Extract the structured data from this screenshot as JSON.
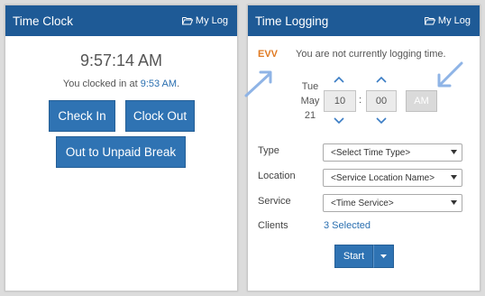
{
  "time_clock": {
    "title": "Time Clock",
    "my_log_label": "My Log",
    "current_time": "9:57:14 AM",
    "clocked_in_prefix": "You clocked in at",
    "clocked_in_time": "9:53 AM",
    "clocked_in_suffix": ".",
    "clock_in_label": "Check In",
    "clock_out_label": "Clock Out",
    "unpaid_break_label": "Out to Unpaid Break"
  },
  "time_logging": {
    "title": "Time Logging",
    "my_log_label": "My Log",
    "evv_label": "EVV",
    "status_text": "You are not currently logging time.",
    "date": {
      "weekday": "Tue",
      "month": "May",
      "day": "21"
    },
    "hour": "10",
    "minute": "00",
    "separator": ":",
    "ampm": "AM",
    "fields": {
      "type_label": "Type",
      "type_value": "<Select Time Type>",
      "location_label": "Location",
      "location_value": "<Service Location Name>",
      "service_label": "Service",
      "service_value": "<Time Service>",
      "clients_label": "Clients",
      "clients_value": "3 Selected"
    },
    "start_label": "Start"
  },
  "colors": {
    "header_blue": "#1e5a96",
    "button_blue": "#2f73b3",
    "link_blue": "#2a6fb0",
    "evv_orange": "#e07a22",
    "hint_arrow": "#8fb4e6"
  },
  "icons": {
    "my_log": "folder-open-icon",
    "chevron_up": "chevron-up-icon",
    "chevron_down": "chevron-down-icon",
    "select_caret": "caret-down-icon",
    "hint_arrow": "pointer-arrow-icon"
  }
}
